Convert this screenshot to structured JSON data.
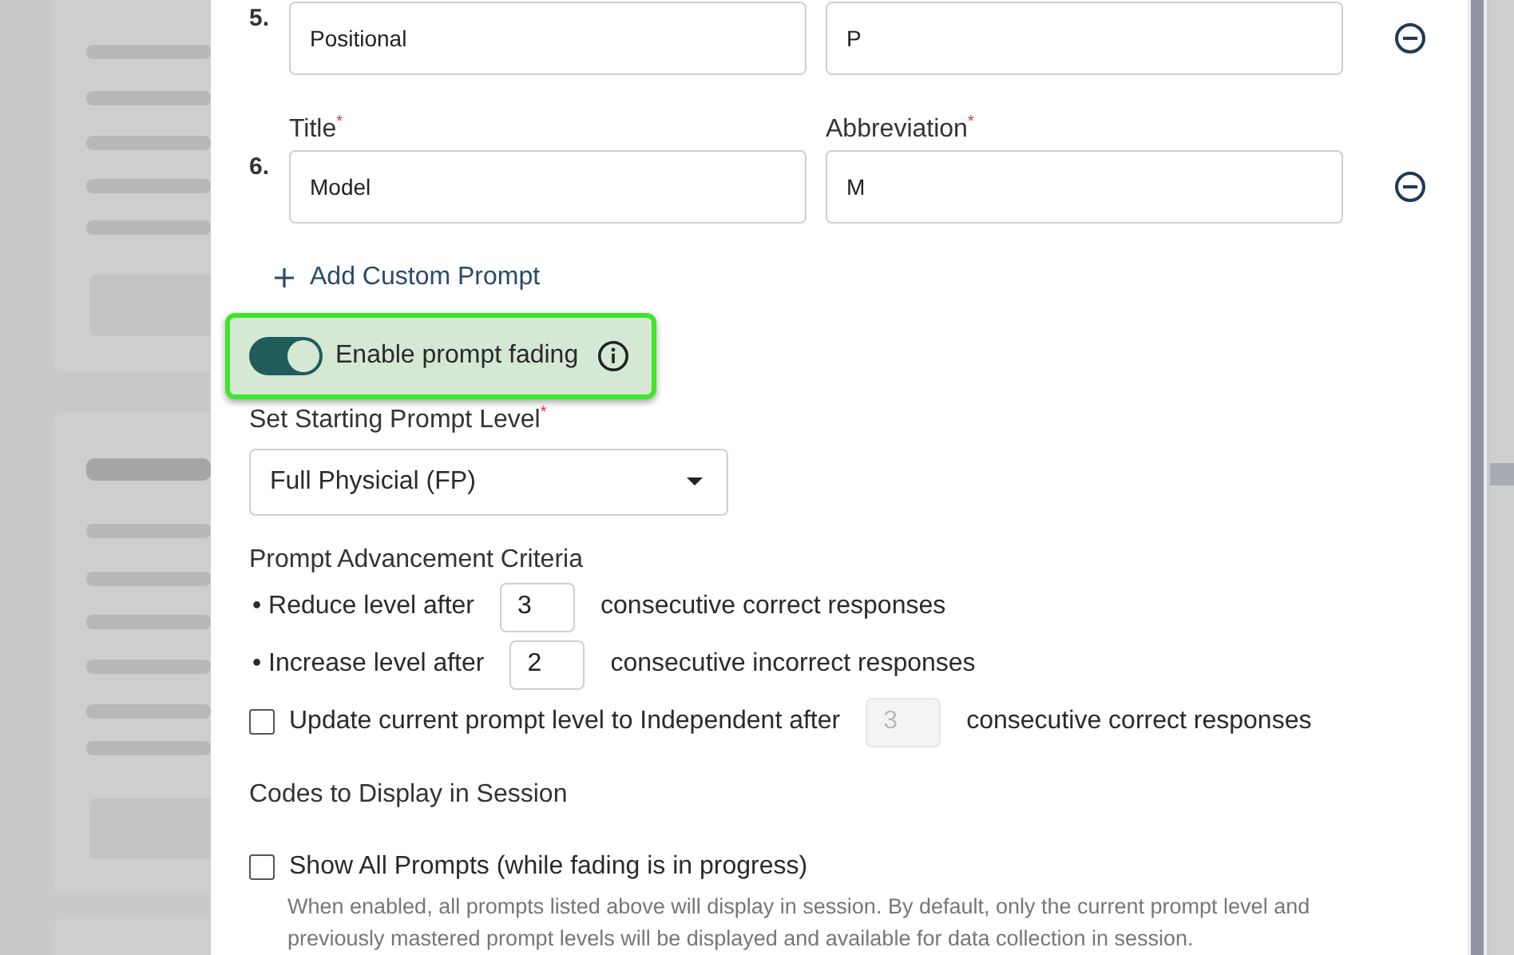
{
  "prompts": [
    {
      "number": "5.",
      "title": "Positional",
      "abbreviation": "P"
    },
    {
      "number": "6.",
      "title_label": "Title",
      "abbreviation_label": "Abbreviation",
      "required_mark": "*",
      "title": "Model",
      "abbreviation": "M"
    }
  ],
  "add_prompt_button": {
    "label": "Add Custom Prompt"
  },
  "fading_toggle": {
    "label": "Enable prompt fading",
    "on": true,
    "highlighted": true
  },
  "starting_level": {
    "label": "Set Starting Prompt Level",
    "required_mark": "*",
    "value": "Full Physicial (FP)"
  },
  "criteria": {
    "heading": "Prompt Advancement Criteria",
    "rows": [
      {
        "bullet": "•",
        "before": "Reduce level after",
        "value": "3",
        "after": "consecutive correct responses"
      },
      {
        "bullet": "•",
        "before": "Increase level after",
        "value": "2",
        "after": "consecutive incorrect responses"
      }
    ]
  },
  "independent": {
    "checked": false,
    "before": "Update current prompt level to Independent after",
    "value": "3",
    "disabled": true,
    "after": "consecutive correct responses"
  },
  "codes": {
    "heading": "Codes to Display in Session",
    "show_all": {
      "checked": false,
      "label": "Show All Prompts (while fading is in progress)",
      "description": "When enabled, all prompts listed above will display in session. By default, only the current prompt level and previously mastered prompt levels will be displayed and available for data collection in session."
    }
  }
}
